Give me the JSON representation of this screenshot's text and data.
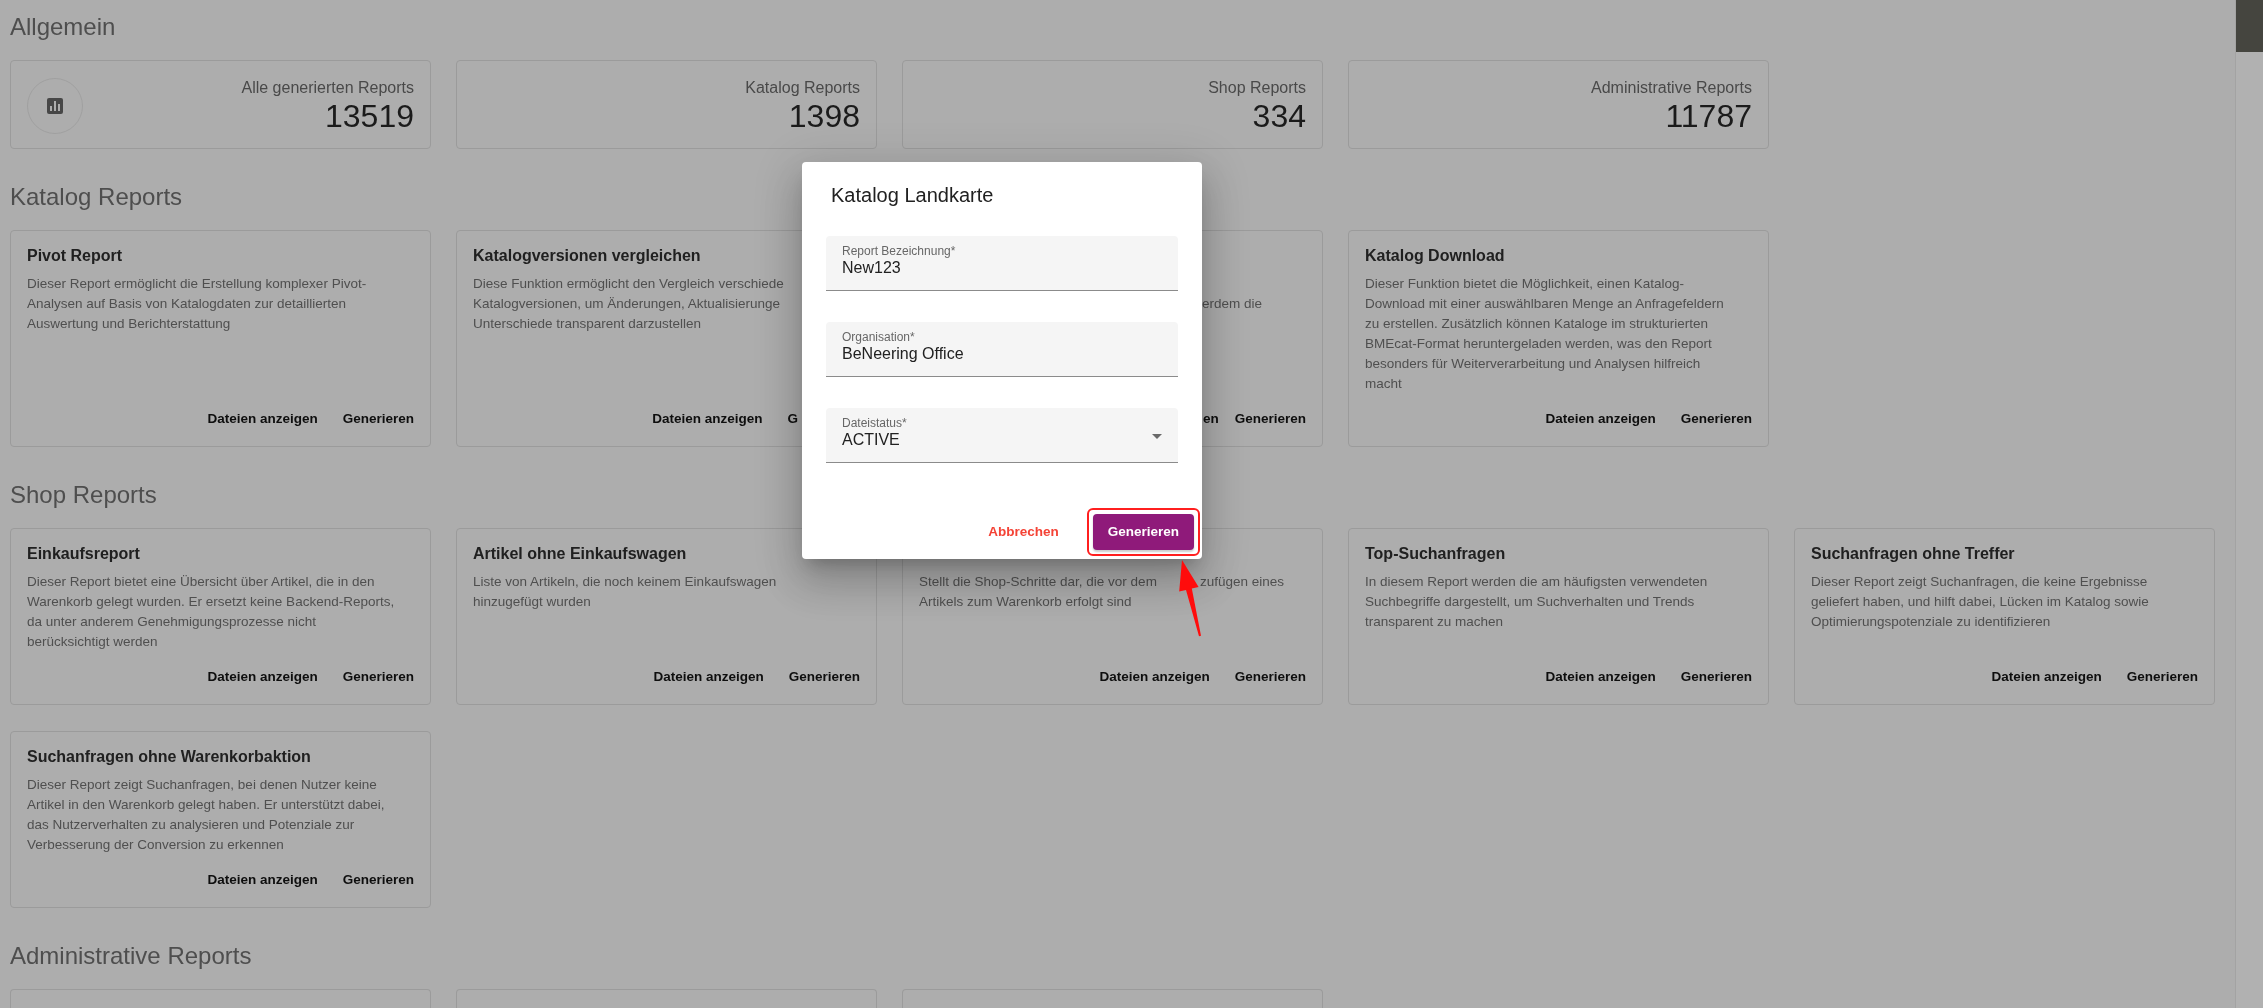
{
  "sections": [
    {
      "title": "Allgemein",
      "kind": "stats",
      "stats": [
        {
          "label": "Alle generierten Reports",
          "value": "13519",
          "has_icon": true
        },
        {
          "label": "Katalog Reports",
          "value": "1398",
          "has_icon": false
        },
        {
          "label": "Shop Reports",
          "value": "334",
          "has_icon": false
        },
        {
          "label": "Administrative Reports",
          "value": "11787",
          "has_icon": false
        }
      ]
    },
    {
      "title": "Katalog Reports",
      "kind": "reports",
      "cards": [
        {
          "kind": "report",
          "title": "Pivot Report",
          "description": "Dieser Report ermöglicht die Erstellung komplexer Pivot-\nAnalysen auf Basis von Katalogdaten zur detaillierten\nAuswertung und Berichterstattung",
          "buttons": [
            "Dateien anzeigen",
            "Generieren"
          ]
        },
        {
          "kind": "covered_right",
          "title": "Katalogversionen vergleichen",
          "description": "Diese Funktion ermöglicht den Vergleich verschiede\nKatalogversionen, um Änderungen, Aktualisierunge\nUnterschiede transparent darzustellen",
          "buttons": [
            "Dateien anzeigen",
            "G"
          ]
        },
        {
          "kind": "covered_left",
          "description": "\nerdem die",
          "buttons": [
            "en",
            "Generieren"
          ]
        },
        {
          "kind": "report",
          "title": "Katalog Download",
          "description": "Dieser Funktion bietet die Möglichkeit, einen Katalog-\nDownload mit einer auswählbaren Menge an Anfragefeldern\nzu erstellen. Zusätzlich können Kataloge im strukturierten\nBMEcat-Format heruntergeladen werden, was den Report\nbesonders für Weiterverarbeitung und Analysen hilfreich\nmacht",
          "buttons": [
            "Dateien anzeigen",
            "Generieren"
          ]
        }
      ]
    },
    {
      "title": "Shop Reports",
      "kind": "reports",
      "cards": [
        {
          "kind": "report",
          "title": "Einkaufsreport",
          "description": "Dieser Report bietet eine Übersicht über Artikel, die in den\nWarenkorb gelegt wurden. Er ersetzt keine Backend-Reports,\nda unter anderem Genehmigungsprozesse nicht\nberücksichtigt werden",
          "buttons": [
            "Dateien anzeigen",
            "Generieren"
          ]
        },
        {
          "kind": "report",
          "title": "Artikel ohne Einkaufswagen",
          "description": "Liste von Artikeln, die noch keinem Einkaufswagen\nhinzugefügt wurden",
          "buttons": [
            "Dateien anzeigen",
            "Generieren"
          ]
        },
        {
          "kind": "interrupted",
          "description_parts": [
            "Stellt die Shop-Schritte dar, die vor dem",
            "zufügen eines",
            "Artikels zum Warenkorb erfolgt sind"
          ],
          "buttons": [
            "Dateien anzeigen",
            "Generieren"
          ]
        },
        {
          "kind": "report",
          "title": "Top-Suchanfragen",
          "description": "In diesem Report werden die am häufigsten verwendeten\nSuchbegriffe dargestellt, um Suchverhalten und Trends\ntransparent zu machen",
          "buttons": [
            "Dateien anzeigen",
            "Generieren"
          ]
        },
        {
          "kind": "report",
          "title": "Suchanfragen ohne Treffer",
          "description": "Dieser Report zeigt Suchanfragen, die keine Ergebnisse\ngeliefert haben, und hilft dabei, Lücken im Katalog sowie\nOptimierungspotenziale zu identifizieren",
          "buttons": [
            "Dateien anzeigen",
            "Generieren"
          ]
        },
        {
          "kind": "report",
          "title": "Suchanfragen ohne Warenkorbaktion",
          "description": "Dieser Report zeigt Suchanfragen, bei denen Nutzer keine\nArtikel in den Warenkorb gelegt haben. Er unterstützt dabei,\ndas Nutzerverhalten zu analysieren und Potenziale zur\nVerbesserung der Conversion zu erkennen",
          "buttons": [
            "Dateien anzeigen",
            "Generieren"
          ]
        }
      ]
    },
    {
      "title": "Administrative Reports",
      "kind": "reports",
      "cards": [
        {
          "kind": "cut_off"
        },
        {
          "kind": "cut_off"
        },
        {
          "kind": "cut_off"
        }
      ]
    }
  ],
  "dialog": {
    "title": "Katalog Landkarte",
    "fields": [
      {
        "label": "Report Bezeichnung*",
        "value": "New123",
        "kind": "text"
      },
      {
        "label": "Organisation*",
        "value": "BeNeering Office",
        "kind": "text"
      },
      {
        "label": "Dateistatus*",
        "value": "ACTIVE",
        "kind": "select"
      }
    ],
    "actions": [
      {
        "label": "Abbrechen",
        "kind": "text",
        "highlighted": false
      },
      {
        "label": "Generieren",
        "kind": "primary",
        "highlighted": true
      }
    ]
  }
}
